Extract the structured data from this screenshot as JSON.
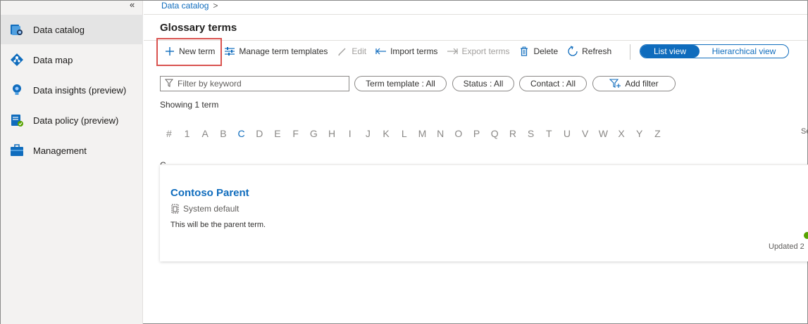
{
  "sidebar": {
    "collapse_glyph": "«",
    "items": [
      {
        "label": "Data catalog",
        "icon": "data-catalog-icon",
        "active": true
      },
      {
        "label": "Data map",
        "icon": "data-map-icon",
        "active": false
      },
      {
        "label": "Data insights (preview)",
        "icon": "data-insights-icon",
        "active": false
      },
      {
        "label": "Data policy (preview)",
        "icon": "data-policy-icon",
        "active": false
      },
      {
        "label": "Management",
        "icon": "management-icon",
        "active": false
      }
    ]
  },
  "breadcrumb": {
    "items": [
      "Data catalog"
    ],
    "separator": ">"
  },
  "page": {
    "title": "Glossary terms"
  },
  "toolbar": {
    "new_term": "New term",
    "manage_templates": "Manage term templates",
    "edit": "Edit",
    "import_terms": "Import terms",
    "export_terms": "Export terms",
    "delete": "Delete",
    "refresh": "Refresh"
  },
  "view_toggle": {
    "list": "List view",
    "hierarchical": "Hierarchical view",
    "selected": "List view"
  },
  "filters": {
    "keyword_placeholder": "Filter by keyword",
    "term_template": "Term template : All",
    "status": "Status : All",
    "contact": "Contact : All",
    "add_filter": "Add filter"
  },
  "showing": "Showing 1 term",
  "alphabet": {
    "letters": [
      "#",
      "1",
      "A",
      "B",
      "C",
      "D",
      "E",
      "F",
      "G",
      "H",
      "I",
      "J",
      "K",
      "L",
      "M",
      "N",
      "O",
      "P",
      "Q",
      "R",
      "S",
      "T",
      "U",
      "V",
      "W",
      "X",
      "Y",
      "Z"
    ],
    "selected": "C",
    "truncated_right": "Se"
  },
  "results": {
    "group_letter": "C",
    "terms": [
      {
        "name": "Contoso Parent",
        "template": "System default",
        "description": "This will be the parent term.",
        "updated": "Updated 2"
      }
    ]
  },
  "colors": {
    "accent": "#0f6cbd",
    "highlight": "#d9534f",
    "status_ok": "#57a300"
  }
}
